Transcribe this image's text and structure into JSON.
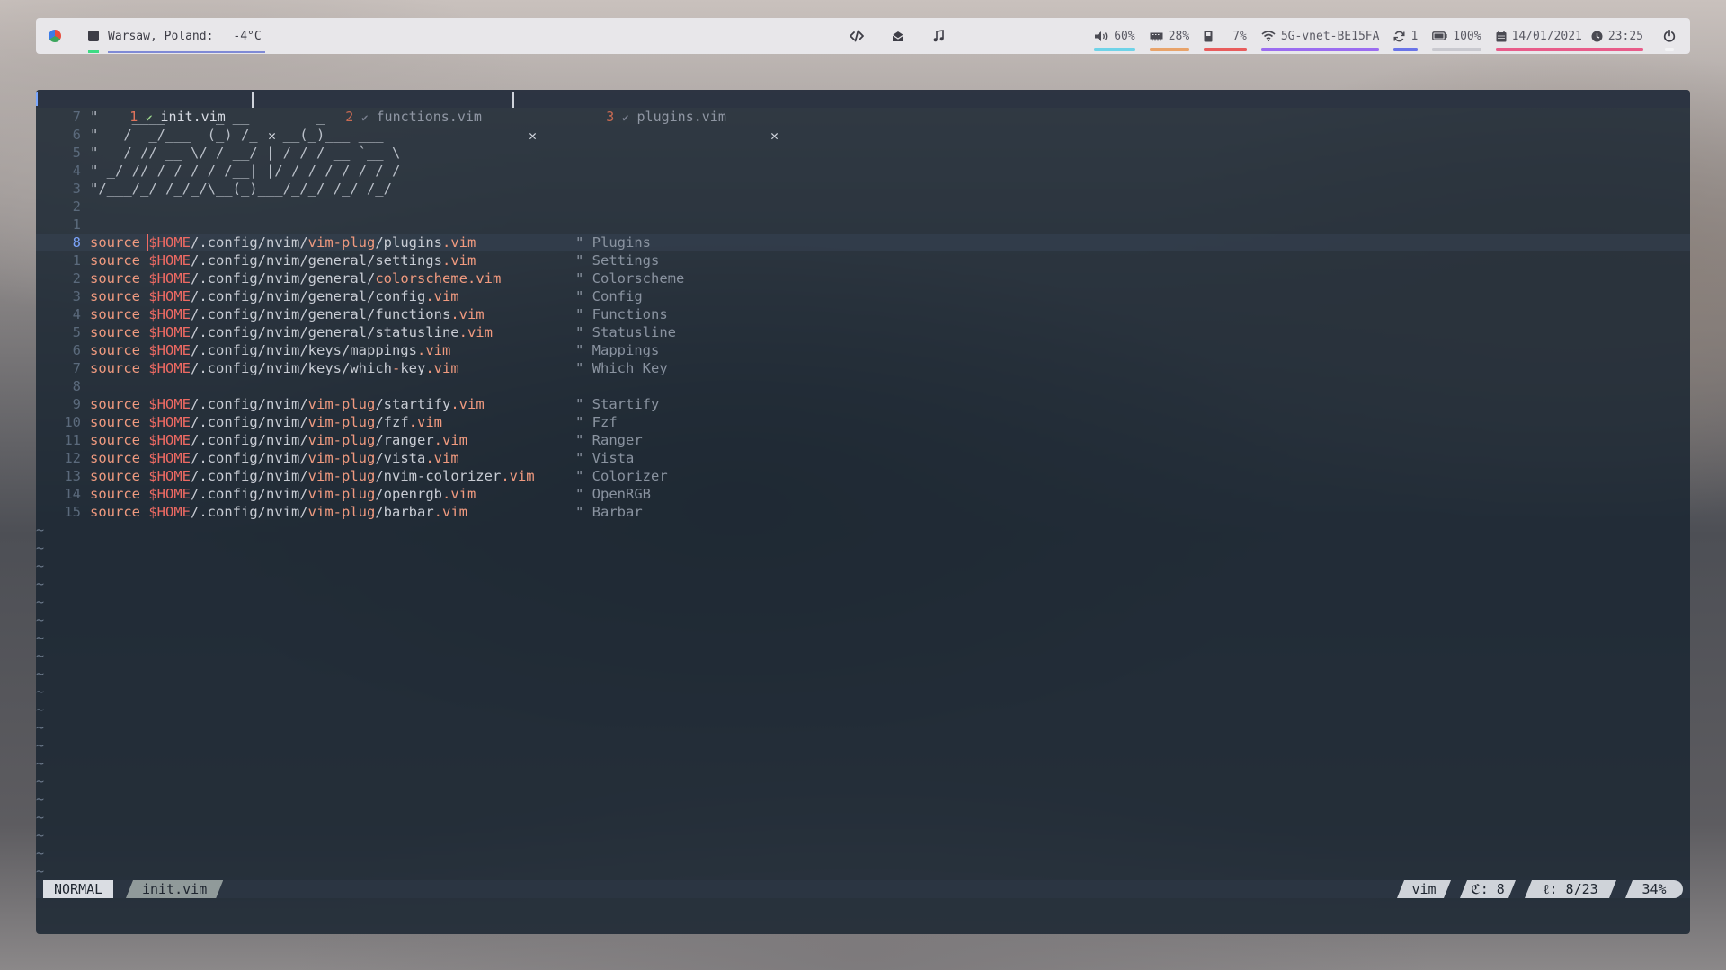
{
  "topbar": {
    "weather_location": "Warsaw, Poland:",
    "weather_temp": "-4°C",
    "volume": "60%",
    "memory": "28%",
    "storage": "7%",
    "wifi": "5G-vnet-BE15FA",
    "updates": "1",
    "battery": "100%",
    "date": "14/01/2021",
    "time": "23:25",
    "colors": {
      "volume": "#6fd3e8",
      "memory": "#e8a36a",
      "storage": "#e85c5c",
      "wifi": "#9b6cf0",
      "updates": "#6a74e8",
      "battery": "#c9c9cf",
      "datetime": "#e85c8a"
    }
  },
  "tabs": [
    {
      "num": "1",
      "check": "✔",
      "name": "init.vim",
      "close": "✕"
    },
    {
      "num": "2",
      "check": "✔",
      "name": "functions.vim",
      "close": "✕"
    },
    {
      "num": "3",
      "check": "✔",
      "name": "plugins.vim",
      "close": "✕"
    }
  ],
  "header_lines": [
    {
      "num": "7",
      "text": "\"    ____      _ __        _"
    },
    {
      "num": "6",
      "text": "\"   /  _/___  (_) /_   __(_)___ ___"
    },
    {
      "num": "5",
      "text": "\"   / // __ \\/ / __/ | / / / __ `__ \\"
    },
    {
      "num": "4",
      "text": "\" _/ // / / / / /__| |/ / / / / / / /"
    },
    {
      "num": "3",
      "text": "\"/___/_/ /_/_/\\__(_)___/_/_/ /_/ /_/"
    },
    {
      "num": "2",
      "text": ""
    },
    {
      "num": "1",
      "text": ""
    }
  ],
  "source_lines": [
    {
      "num": "8",
      "kw": "source",
      "var": "$HOME",
      "path": "/.config/nvim/",
      "d1": "vim-plug",
      "rest": "/plugins",
      "ext": ".vim",
      "comment": "\" Plugins",
      "current": true
    },
    {
      "num": "1",
      "kw": "source",
      "var": "$HOME",
      "path": "/.config/nvim/general/settings",
      "d1": "",
      "rest": "",
      "ext": ".vim",
      "comment": "\" Settings"
    },
    {
      "num": "2",
      "kw": "source",
      "var": "$HOME",
      "path": "/.config/nvim/general/",
      "d1": "colorscheme",
      "rest": "",
      "ext": ".vim",
      "comment": "\" Colorscheme"
    },
    {
      "num": "3",
      "kw": "source",
      "var": "$HOME",
      "path": "/.config/nvim/general/config",
      "d1": "",
      "rest": "",
      "ext": ".vim",
      "comment": "\" Config"
    },
    {
      "num": "4",
      "kw": "source",
      "var": "$HOME",
      "path": "/.config/nvim/general/functions",
      "d1": "",
      "rest": "",
      "ext": ".vim",
      "comment": "\" Functions"
    },
    {
      "num": "5",
      "kw": "source",
      "var": "$HOME",
      "path": "/.config/nvim/general/statusline",
      "d1": "",
      "rest": "",
      "ext": ".vim",
      "comment": "\" Statusline"
    },
    {
      "num": "6",
      "kw": "source",
      "var": "$HOME",
      "path": "/.config/nvim/keys/mappings",
      "d1": "",
      "rest": "",
      "ext": ".vim",
      "comment": "\" Mappings"
    },
    {
      "num": "7",
      "kw": "source",
      "var": "$HOME",
      "path": "/.config/nvim/keys/which",
      "d1": "-",
      "rest": "key",
      "ext": ".vim",
      "comment": "\" Which Key"
    },
    {
      "num": "8",
      "kw": "",
      "var": "",
      "path": "",
      "d1": "",
      "rest": "",
      "ext": "",
      "comment": ""
    },
    {
      "num": "9",
      "kw": "source",
      "var": "$HOME",
      "path": "/.config/nvim/",
      "d1": "vim-plug",
      "rest": "/startify",
      "ext": ".vim",
      "comment": "\" Startify"
    },
    {
      "num": "10",
      "kw": "source",
      "var": "$HOME",
      "path": "/.config/nvim/",
      "d1": "vim-plug",
      "rest": "/fzf",
      "ext": ".vim",
      "comment": "\" Fzf"
    },
    {
      "num": "11",
      "kw": "source",
      "var": "$HOME",
      "path": "/.config/nvim/",
      "d1": "vim-plug",
      "rest": "/ranger",
      "ext": ".vim",
      "comment": "\" Ranger"
    },
    {
      "num": "12",
      "kw": "source",
      "var": "$HOME",
      "path": "/.config/nvim/",
      "d1": "vim-plug",
      "rest": "/vista",
      "ext": ".vim",
      "comment": "\" Vista"
    },
    {
      "num": "13",
      "kw": "source",
      "var": "$HOME",
      "path": "/.config/nvim/",
      "d1": "vim-plug",
      "rest": "/nvim-colorizer",
      "ext": ".vim",
      "comment": "\" Colorizer"
    },
    {
      "num": "14",
      "kw": "source",
      "var": "$HOME",
      "path": "/.config/nvim/",
      "d1": "vim-plug",
      "rest": "/openrgb",
      "ext": ".vim",
      "comment": "\" OpenRGB"
    },
    {
      "num": "15",
      "kw": "source",
      "var": "$HOME",
      "path": "/.config/nvim/",
      "d1": "vim-plug",
      "rest": "/barbar",
      "ext": ".vim",
      "comment": "\" Barbar"
    }
  ],
  "tilde_char": "~",
  "statusline": {
    "mode": "NORMAL",
    "file": "init.vim",
    "filetype": "vim",
    "column": "ℭ: 8",
    "line": "ℓ: 8/23",
    "percent": "34%"
  }
}
